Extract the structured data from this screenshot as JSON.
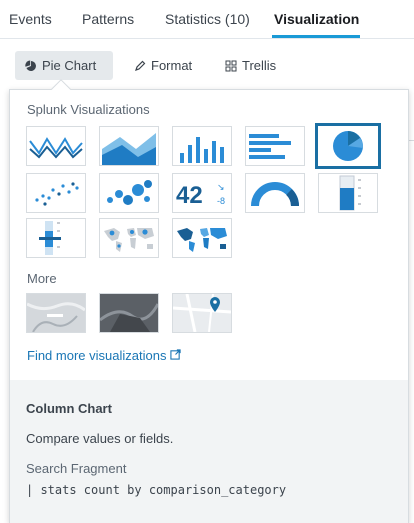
{
  "tabs": [
    {
      "label": "Events"
    },
    {
      "label": "Patterns"
    },
    {
      "label": "Statistics (10)"
    },
    {
      "label": "Visualization"
    }
  ],
  "active_tab": "Visualization",
  "toolbar": {
    "pie_chart": {
      "label": "Pie Chart",
      "icon": "pie-chart-icon"
    },
    "format": {
      "label": "Format",
      "icon": "pencil-icon"
    },
    "trellis": {
      "label": "Trellis",
      "icon": "grid-icon"
    }
  },
  "picker": {
    "splunk_label": "Splunk Visualizations",
    "more_label": "More",
    "find_more_label": "Find more visualizations",
    "find_more_icon": "external-link-icon",
    "splunk_viz": [
      {
        "icon": "line-chart-icon"
      },
      {
        "icon": "area-chart-icon"
      },
      {
        "icon": "column-chart-icon"
      },
      {
        "icon": "bar-chart-icon"
      },
      {
        "icon": "pie-chart-icon",
        "selected": true
      },
      {
        "icon": "scatter-chart-icon"
      },
      {
        "icon": "bubble-chart-icon"
      },
      {
        "icon": "single-value-icon",
        "value_text": "42",
        "delta_text": "-8"
      },
      {
        "icon": "radial-gauge-icon"
      },
      {
        "icon": "filler-gauge-icon"
      },
      {
        "icon": "marker-gauge-icon"
      },
      {
        "icon": "cluster-map-icon"
      },
      {
        "icon": "choropleth-map-icon"
      }
    ],
    "more_viz": [
      {
        "icon": "custom-viz-1-icon"
      },
      {
        "icon": "custom-viz-2-icon"
      },
      {
        "icon": "location-map-icon"
      }
    ]
  },
  "description": {
    "title": "Column Chart",
    "text": "Compare values or fields.",
    "fragment_label": "Search Fragment",
    "fragment": "| stats count by comparison_category"
  },
  "colors": {
    "accent": "#1a9ad6",
    "selected_border": "#1a6fa3",
    "link": "#1a76b5",
    "viz_blue": "#2b8cd6"
  }
}
